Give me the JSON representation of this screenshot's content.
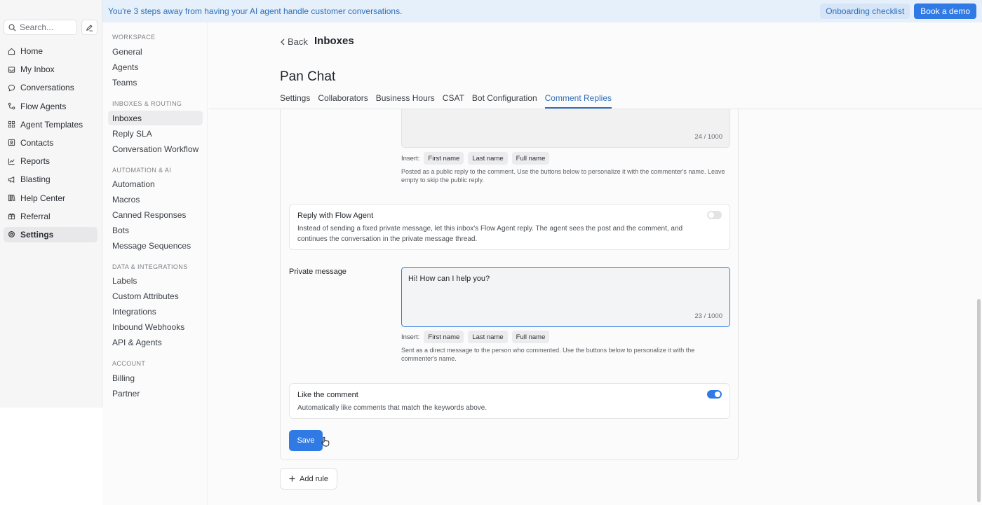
{
  "banner": {
    "text": "You're 3 steps away from having your AI agent handle customer conversations.",
    "onboarding_label": "Onboarding checklist",
    "demo_label": "Book a demo"
  },
  "search": {
    "placeholder": "Search..."
  },
  "nav": [
    {
      "label": "Home",
      "icon": "home-icon"
    },
    {
      "label": "My Inbox",
      "icon": "inbox-icon"
    },
    {
      "label": "Conversations",
      "icon": "chat-bubble-icon"
    },
    {
      "label": "Flow Agents",
      "icon": "flow-icon"
    },
    {
      "label": "Agent Templates",
      "icon": "grid-icon"
    },
    {
      "label": "Contacts",
      "icon": "contacts-icon"
    },
    {
      "label": "Reports",
      "icon": "chart-icon"
    },
    {
      "label": "Blasting",
      "icon": "megaphone-icon"
    },
    {
      "label": "Help Center",
      "icon": "book-icon"
    },
    {
      "label": "Referral",
      "icon": "gift-icon"
    },
    {
      "label": "Settings",
      "icon": "gear-icon",
      "active": true
    }
  ],
  "settings_nav": {
    "workspace_title": "WORKSPACE",
    "workspace": [
      "General",
      "Agents",
      "Teams"
    ],
    "routing_title": "INBOXES & ROUTING",
    "routing": [
      "Inboxes",
      "Reply SLA",
      "Conversation Workflow"
    ],
    "automation_title": "AUTOMATION & AI",
    "automation": [
      "Automation",
      "Macros",
      "Canned Responses",
      "Bots",
      "Message Sequences"
    ],
    "data_title": "DATA & INTEGRATIONS",
    "data": [
      "Labels",
      "Custom Attributes",
      "Integrations",
      "Inbound Webhooks",
      "API & Agents"
    ],
    "account_title": "ACCOUNT",
    "account": [
      "Billing",
      "Partner"
    ]
  },
  "header": {
    "back_label": "Back",
    "breadcrumb": "Inboxes",
    "title": "Pan Chat",
    "tabs": [
      "Settings",
      "Collaborators",
      "Business Hours",
      "CSAT",
      "Bot Configuration",
      "Comment Replies"
    ],
    "active_tab": "Comment Replies"
  },
  "public_reply": {
    "counter": "24 / 1000",
    "insert_label": "Insert:",
    "chips": [
      "First name",
      "Last name",
      "Full name"
    ],
    "help": "Posted as a public reply to the comment. Use the buttons below to personalize it with the commenter's name. Leave empty to skip the public reply."
  },
  "flow_agent": {
    "title": "Reply with Flow Agent",
    "description": "Instead of sending a fixed private message, let this inbox's Flow Agent reply. The agent sees the post and the comment, and continues the conversation in the private message thread.",
    "enabled": false
  },
  "private_message": {
    "label": "Private message",
    "value": "Hi! How can I help you?",
    "counter": "23 / 1000",
    "insert_label": "Insert:",
    "chips": [
      "First name",
      "Last name",
      "Full name"
    ],
    "help": "Sent as a direct message to the person who commented. Use the buttons below to personalize it with the commenter's name."
  },
  "like_comment": {
    "title": "Like the comment",
    "description": "Automatically like comments that match the keywords above.",
    "enabled": true
  },
  "actions": {
    "save_label": "Save",
    "add_rule_label": "Add rule"
  },
  "colors": {
    "accent": "#2f7ae5",
    "banner_bg": "#e6f0fb",
    "link": "#2f6fb7"
  }
}
